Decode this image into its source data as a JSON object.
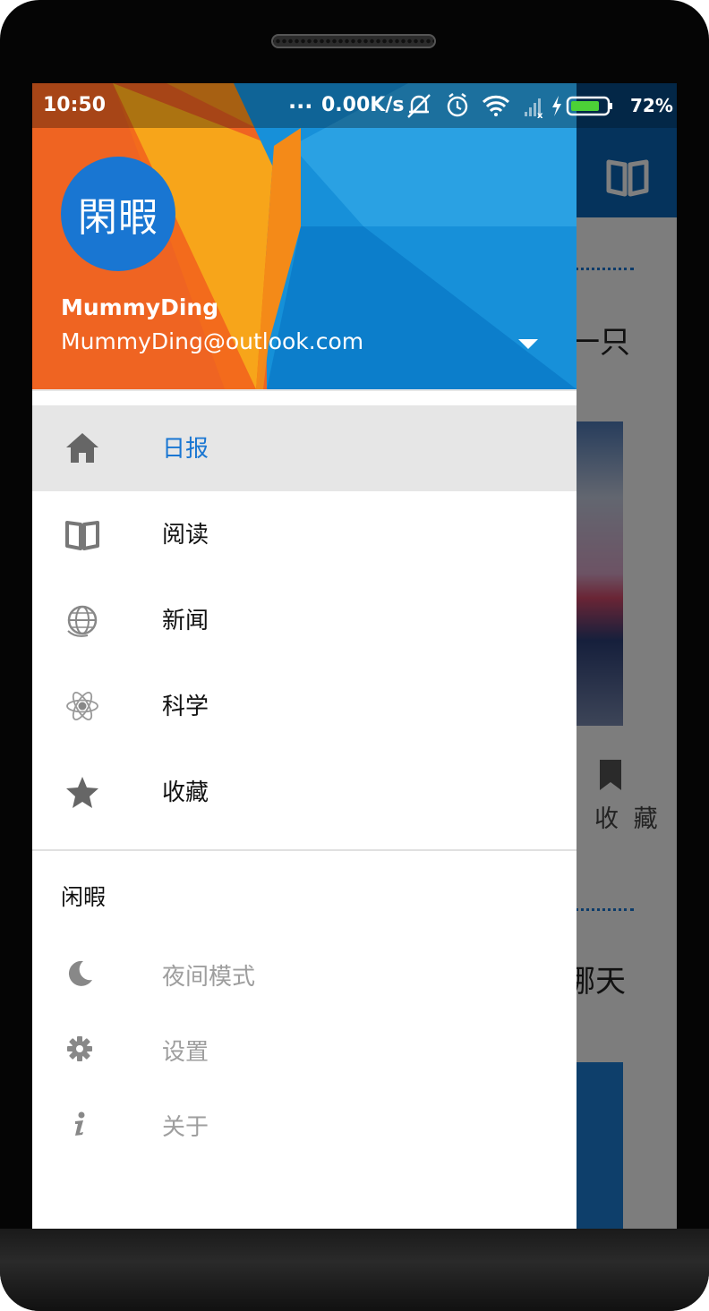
{
  "status_bar": {
    "time": "10:50",
    "dots": "...",
    "net_speed": "0.00K/s",
    "battery_percent": "72%"
  },
  "header": {
    "avatar_text": "閑暇",
    "user_name": "MummyDing",
    "user_email": "MummyDing@outlook.com"
  },
  "nav": {
    "items": [
      {
        "label": "日报",
        "icon": "home-icon",
        "active": true
      },
      {
        "label": "阅读",
        "icon": "book-icon",
        "active": false
      },
      {
        "label": "新闻",
        "icon": "globe-icon",
        "active": false
      },
      {
        "label": "科学",
        "icon": "atom-icon",
        "active": false
      },
      {
        "label": "收藏",
        "icon": "star-icon",
        "active": false
      }
    ]
  },
  "section": {
    "title": "闲暇",
    "items": [
      {
        "label": "夜间模式",
        "icon": "moon-icon"
      },
      {
        "label": "设置",
        "icon": "gear-icon"
      },
      {
        "label": "关于",
        "icon": "info-icon"
      }
    ]
  },
  "background_app": {
    "headline_1_fragment": "一只",
    "headline_2_fragment": "哪天",
    "favorite_label": "收 藏"
  },
  "colors": {
    "accent": "#1976d2",
    "active_row": "#e6e6e6",
    "toolbar": "#0a66b8"
  }
}
